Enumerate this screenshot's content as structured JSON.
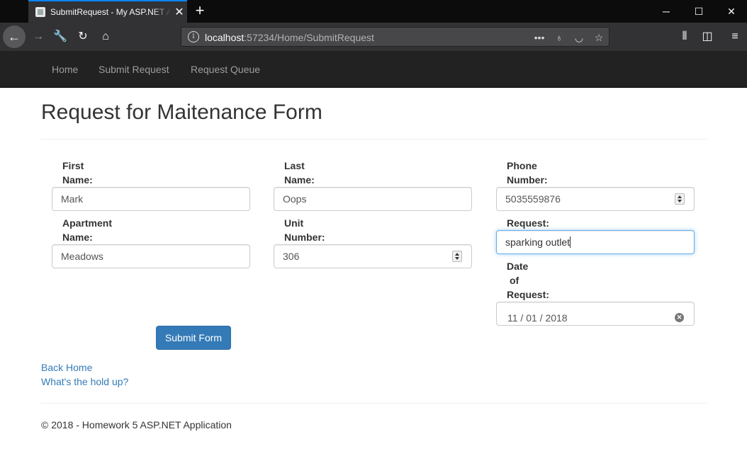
{
  "browser": {
    "tab_title": "SubmitRequest - My ASP.NET Application",
    "url_host": "localhost",
    "url_rest": ":57234/Home/SubmitRequest"
  },
  "site_nav": {
    "items": [
      "Home",
      "Submit Request",
      "Request Queue"
    ]
  },
  "page": {
    "title": "Request for Maitenance Form"
  },
  "form": {
    "first_name": {
      "label_line1": "First",
      "label_line2": "Name:",
      "value": "Mark"
    },
    "last_name": {
      "label_line1": "Last",
      "label_line2": "Name:",
      "value": "Oops"
    },
    "phone": {
      "label_line1": "Phone",
      "label_line2": "Number:",
      "value": "5035559876"
    },
    "apartment": {
      "label_line1": "Apartment",
      "label_line2": "Name:",
      "value": "Meadows"
    },
    "unit": {
      "label_line1": "Unit",
      "label_line2": "Number:",
      "value": "306"
    },
    "request": {
      "label": "Request:",
      "value": "sparking outlet"
    },
    "date": {
      "label_line1": "Date",
      "label_line2": "of",
      "label_line3": "Request:",
      "value": "11 / 01 / 2018"
    },
    "submit_label": "Submit Form"
  },
  "links": {
    "back_home": "Back Home",
    "hold_up": "What's the hold up?"
  },
  "footer": {
    "text": "© 2018 - Homework 5 ASP.NET Application"
  }
}
